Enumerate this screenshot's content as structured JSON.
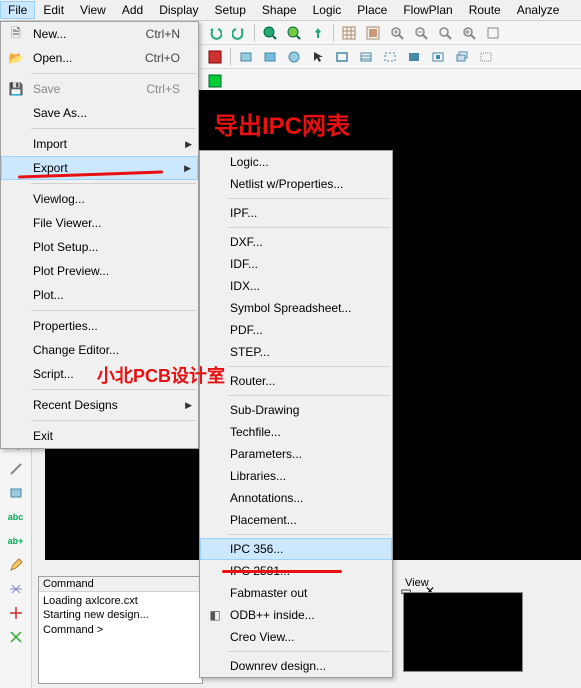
{
  "menubar": [
    "File",
    "Edit",
    "View",
    "Add",
    "Display",
    "Setup",
    "Shape",
    "Logic",
    "Place",
    "FlowPlan",
    "Route",
    "Analyze"
  ],
  "file_menu": {
    "new": {
      "label": "New...",
      "accel": "Ctrl+N"
    },
    "open": {
      "label": "Open...",
      "accel": "Ctrl+O"
    },
    "save": {
      "label": "Save",
      "accel": "Ctrl+S"
    },
    "saveas": {
      "label": "Save As..."
    },
    "import": {
      "label": "Import"
    },
    "export": {
      "label": "Export"
    },
    "viewlog": {
      "label": "Viewlog..."
    },
    "fileviewer": {
      "label": "File Viewer..."
    },
    "plotsetup": {
      "label": "Plot Setup..."
    },
    "plotpreview": {
      "label": "Plot Preview..."
    },
    "plot": {
      "label": "Plot..."
    },
    "properties": {
      "label": "Properties..."
    },
    "changeed": {
      "label": "Change Editor..."
    },
    "script": {
      "label": "Script..."
    },
    "recent": {
      "label": "Recent Designs"
    },
    "exit": {
      "label": "Exit"
    }
  },
  "export_menu": {
    "logic": {
      "label": "Logic..."
    },
    "netlist": {
      "label": "Netlist w/Properties..."
    },
    "ipf": {
      "label": "IPF..."
    },
    "dxf": {
      "label": "DXF..."
    },
    "idf": {
      "label": "IDF..."
    },
    "idx": {
      "label": "IDX..."
    },
    "symsheet": {
      "label": "Symbol Spreadsheet..."
    },
    "pdf": {
      "label": "PDF..."
    },
    "step": {
      "label": "STEP..."
    },
    "router": {
      "label": "Router..."
    },
    "subdraw": {
      "label": "Sub-Drawing"
    },
    "techfile": {
      "label": "Techfile..."
    },
    "params": {
      "label": "Parameters..."
    },
    "libs": {
      "label": "Libraries..."
    },
    "annot": {
      "label": "Annotations..."
    },
    "placement": {
      "label": "Placement..."
    },
    "ipc356": {
      "label": "IPC 356..."
    },
    "ipc2581": {
      "label": "IPC 2581..."
    },
    "fabmaster": {
      "label": "Fabmaster out"
    },
    "odb": {
      "label": "ODB++ inside..."
    },
    "creo": {
      "label": "Creo View..."
    },
    "downrev": {
      "label": "Downrev design..."
    }
  },
  "command": {
    "title": "Command",
    "lines": [
      "Loading axlcore.cxt",
      "Starting new design...",
      "Command >"
    ]
  },
  "view": {
    "title": "View"
  },
  "annotations": {
    "title_red": "导出IPC网表",
    "watermark": "小北PCB设计室"
  }
}
